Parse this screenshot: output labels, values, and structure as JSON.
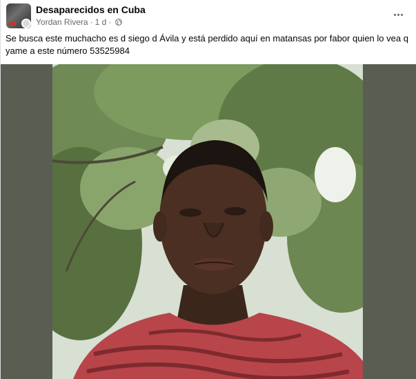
{
  "group": {
    "name": "Desaparecidos en Cuba"
  },
  "meta": {
    "author": "Yordan Rivera",
    "separator": "·",
    "time": "1 d",
    "time_separator": "·",
    "audience_icon": "globe-icon"
  },
  "actions": {
    "more_icon": "more-options-icon"
  },
  "post": {
    "text": "Se busca este muchacho es d siego d Ávila y está perdido aquí en matansas por fabor quien lo vea q yame a este número 53525984"
  },
  "photo": {
    "subject": "person-photo"
  },
  "colors": {
    "text_primary": "#050505",
    "text_secondary": "#65676b",
    "photo_background": "#5a5e52"
  }
}
